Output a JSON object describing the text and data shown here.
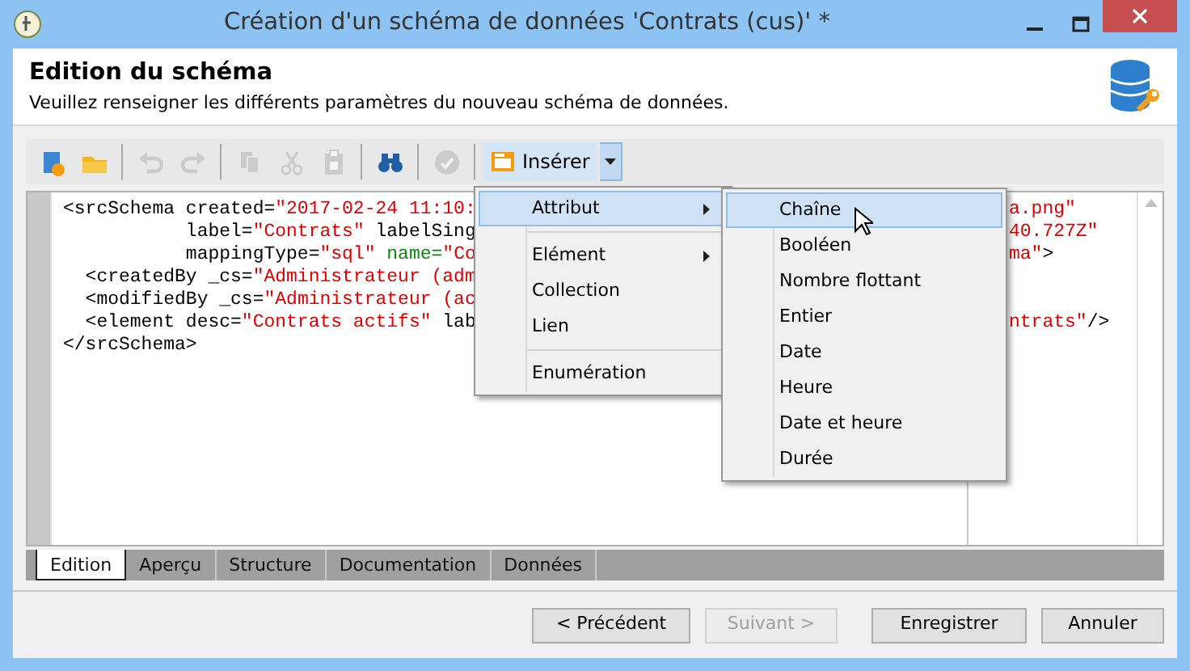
{
  "window": {
    "title": "Création d'un schéma de données 'Contrats (cus)' *"
  },
  "header": {
    "title": "Edition du schéma",
    "subtitle": "Veuillez renseigner les différents paramètres du nouveau schéma de données."
  },
  "toolbar": [
    {
      "kind": "new",
      "disabled": false
    },
    {
      "kind": "open",
      "disabled": false
    },
    {
      "kind": "separator"
    },
    {
      "kind": "undo",
      "disabled": true
    },
    {
      "kind": "redo",
      "disabled": true
    },
    {
      "kind": "separator"
    },
    {
      "kind": "copy",
      "disabled": true
    },
    {
      "kind": "cut",
      "disabled": true
    },
    {
      "kind": "paste",
      "disabled": true
    },
    {
      "kind": "separator"
    },
    {
      "kind": "find",
      "disabled": false
    },
    {
      "kind": "separator"
    },
    {
      "kind": "check",
      "disabled": true
    },
    {
      "kind": "separator"
    },
    {
      "kind": "insert",
      "label": "Insérer",
      "pressed": true
    }
  ],
  "code_lines": [
    {
      "left": [
        {
          "kind": "tag",
          "text": "<srcSchema created="
        },
        {
          "kind": "value",
          "text": "\"2017-02-24 11:10:"
        }
      ],
      "right": [
        {
          "kind": "value",
          "text": "a.png\""
        }
      ]
    },
    {
      "left": [
        {
          "kind": "tag",
          "text": "           label="
        },
        {
          "kind": "value",
          "text": "\"Contrats\""
        },
        {
          "kind": "tag",
          "text": " labelSing"
        }
      ],
      "right": [
        {
          "kind": "value",
          "text": "40.727Z\""
        }
      ]
    },
    {
      "left": [
        {
          "kind": "tag",
          "text": "           mappingType="
        },
        {
          "kind": "value",
          "text": "\"sql\""
        },
        {
          "kind": "key",
          "text": " name="
        },
        {
          "kind": "value",
          "text": "\"Co"
        }
      ],
      "right": [
        {
          "kind": "value",
          "text": "ma\""
        },
        {
          "kind": "tag",
          "text": ">"
        }
      ]
    },
    {
      "left": [
        {
          "kind": "tag",
          "text": "  <createdBy _cs="
        },
        {
          "kind": "value",
          "text": "\"Administrateur (adm"
        }
      ]
    },
    {
      "left": [
        {
          "kind": "tag",
          "text": "  <modifiedBy _cs="
        },
        {
          "kind": "value",
          "text": "\"Administrateur (ac"
        }
      ]
    },
    {
      "left": [
        {
          "kind": "tag",
          "text": "  <element desc="
        },
        {
          "kind": "value",
          "text": "\"Contrats actifs\""
        },
        {
          "kind": "tag",
          "text": " lab"
        }
      ],
      "right": [
        {
          "kind": "value",
          "text": "ntrats\""
        },
        {
          "kind": "tag",
          "text": "/>"
        }
      ]
    },
    {
      "left": [
        {
          "kind": "tag",
          "text": "</srcSchema>"
        }
      ]
    }
  ],
  "menu": [
    {
      "kind": "item",
      "label": "Attribut",
      "submenu": true,
      "selected": true
    },
    {
      "kind": "separator"
    },
    {
      "kind": "item",
      "label": "Elément",
      "submenu": true,
      "selected": false
    },
    {
      "kind": "item",
      "label": "Collection",
      "submenu": false,
      "selected": false
    },
    {
      "kind": "item",
      "label": "Lien",
      "submenu": false,
      "selected": false
    },
    {
      "kind": "separator"
    },
    {
      "kind": "item",
      "label": "Enumération",
      "submenu": false,
      "selected": false
    }
  ],
  "submenu": [
    {
      "label": "Chaîne",
      "selected": true
    },
    {
      "label": "Booléen",
      "selected": false
    },
    {
      "label": "Nombre flottant",
      "selected": false
    },
    {
      "label": "Entier",
      "selected": false
    },
    {
      "label": "Date",
      "selected": false
    },
    {
      "label": "Heure",
      "selected": false
    },
    {
      "label": "Date et heure",
      "selected": false
    },
    {
      "label": "Durée",
      "selected": false
    }
  ],
  "tabs": [
    {
      "label": "Edition",
      "selected": true
    },
    {
      "label": "Aperçu",
      "selected": false
    },
    {
      "label": "Structure",
      "selected": false
    },
    {
      "label": "Documentation",
      "selected": false
    },
    {
      "label": "Données",
      "selected": false
    }
  ],
  "buttons": [
    {
      "label": "< Précédent",
      "disabled": false
    },
    {
      "label": "Suivant >",
      "disabled": true
    },
    {
      "label": "Enregistrer",
      "disabled": false
    },
    {
      "label": "Annuler",
      "disabled": false
    }
  ]
}
